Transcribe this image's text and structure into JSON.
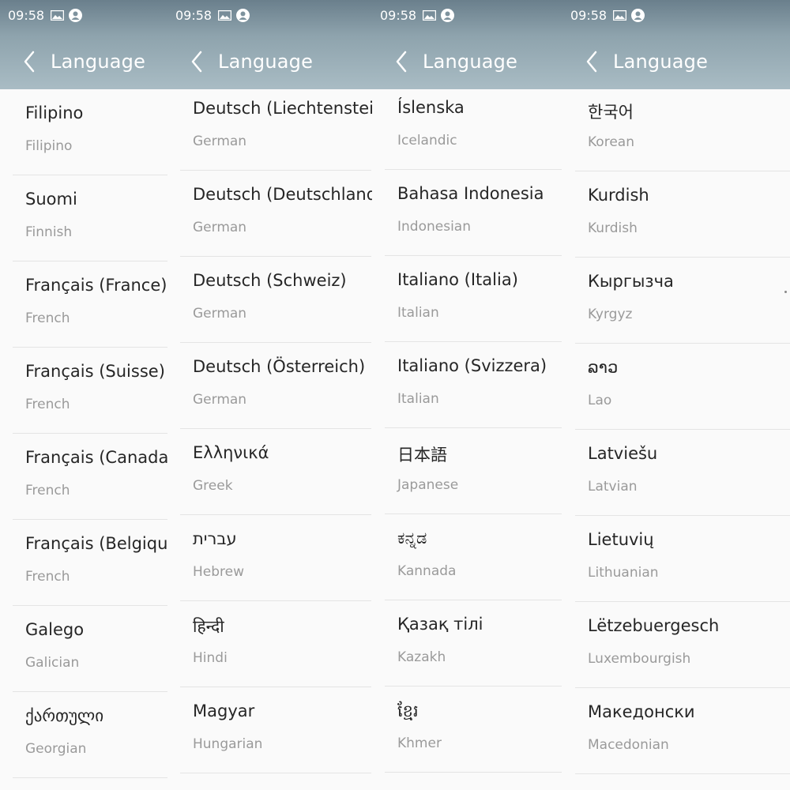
{
  "panels": [
    {
      "time": "09:58",
      "title": "Language",
      "items": [
        {
          "name": "Filipino",
          "sub": "Filipino"
        },
        {
          "name": "Suomi",
          "sub": "Finnish"
        },
        {
          "name": "Français (France)",
          "sub": "French"
        },
        {
          "name": "Français (Suisse)",
          "sub": "French"
        },
        {
          "name": "Français (Canada)",
          "sub": "French"
        },
        {
          "name": "Français (Belgique)",
          "sub": "French"
        },
        {
          "name": "Galego",
          "sub": "Galician"
        },
        {
          "name": "ქართული",
          "sub": "Georgian"
        }
      ]
    },
    {
      "time": "09:58",
      "title": "Language",
      "items": [
        {
          "name": "Deutsch (Liechtenstein)",
          "sub": "German"
        },
        {
          "name": "Deutsch (Deutschland)",
          "sub": "German"
        },
        {
          "name": "Deutsch (Schweiz)",
          "sub": "German"
        },
        {
          "name": "Deutsch (Österreich)",
          "sub": "German"
        },
        {
          "name": "Ελληνικά",
          "sub": "Greek"
        },
        {
          "name": "עברית",
          "sub": "Hebrew"
        },
        {
          "name": "हिन्दी",
          "sub": "Hindi"
        },
        {
          "name": "Magyar",
          "sub": "Hungarian"
        }
      ]
    },
    {
      "time": "09:58",
      "title": "Language",
      "items": [
        {
          "name": "Íslenska",
          "sub": "Icelandic"
        },
        {
          "name": "Bahasa Indonesia",
          "sub": "Indonesian"
        },
        {
          "name": "Italiano (Italia)",
          "sub": "Italian"
        },
        {
          "name": "Italiano (Svizzera)",
          "sub": "Italian"
        },
        {
          "name": "日本語",
          "sub": "Japanese"
        },
        {
          "name": "ಕನ್ನಡ",
          "sub": "Kannada"
        },
        {
          "name": "Қазақ тілі",
          "sub": "Kazakh"
        },
        {
          "name": "ខ្មែរ",
          "sub": "Khmer"
        }
      ]
    },
    {
      "time": "09:58",
      "title": "Language",
      "items": [
        {
          "name": "한국어",
          "sub": "Korean"
        },
        {
          "name": "Kurdish",
          "sub": "Kurdish"
        },
        {
          "name": "Кыргызча",
          "sub": "Kyrgyz"
        },
        {
          "name": "ລາວ",
          "sub": "Lao"
        },
        {
          "name": "Latviešu",
          "sub": "Latvian"
        },
        {
          "name": "Lietuvių",
          "sub": "Lithuanian"
        },
        {
          "name": "Lëtzebuergesch",
          "sub": "Luxembourgish"
        },
        {
          "name": "Македонски",
          "sub": "Macedonian"
        }
      ]
    }
  ]
}
